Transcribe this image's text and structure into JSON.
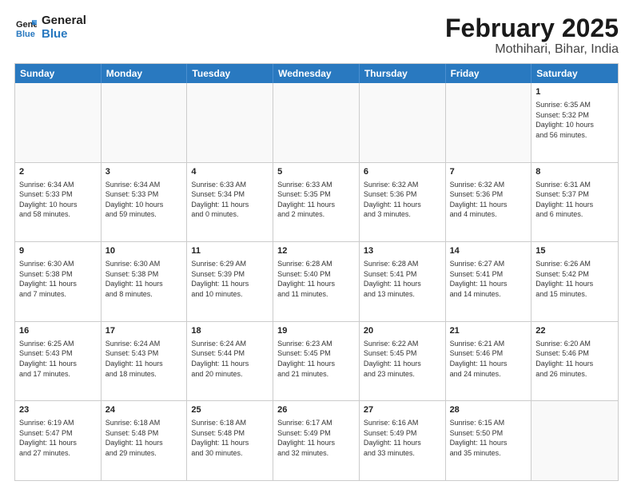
{
  "logo": {
    "text_general": "General",
    "text_blue": "Blue"
  },
  "title": "February 2025",
  "subtitle": "Mothihari, Bihar, India",
  "header_days": [
    "Sunday",
    "Monday",
    "Tuesday",
    "Wednesday",
    "Thursday",
    "Friday",
    "Saturday"
  ],
  "rows": [
    [
      {
        "num": "",
        "text": "",
        "empty": true
      },
      {
        "num": "",
        "text": "",
        "empty": true
      },
      {
        "num": "",
        "text": "",
        "empty": true
      },
      {
        "num": "",
        "text": "",
        "empty": true
      },
      {
        "num": "",
        "text": "",
        "empty": true
      },
      {
        "num": "",
        "text": "",
        "empty": true
      },
      {
        "num": "1",
        "text": "Sunrise: 6:35 AM\nSunset: 5:32 PM\nDaylight: 10 hours\nand 56 minutes.",
        "empty": false
      }
    ],
    [
      {
        "num": "2",
        "text": "Sunrise: 6:34 AM\nSunset: 5:33 PM\nDaylight: 10 hours\nand 58 minutes.",
        "empty": false
      },
      {
        "num": "3",
        "text": "Sunrise: 6:34 AM\nSunset: 5:33 PM\nDaylight: 10 hours\nand 59 minutes.",
        "empty": false
      },
      {
        "num": "4",
        "text": "Sunrise: 6:33 AM\nSunset: 5:34 PM\nDaylight: 11 hours\nand 0 minutes.",
        "empty": false
      },
      {
        "num": "5",
        "text": "Sunrise: 6:33 AM\nSunset: 5:35 PM\nDaylight: 11 hours\nand 2 minutes.",
        "empty": false
      },
      {
        "num": "6",
        "text": "Sunrise: 6:32 AM\nSunset: 5:36 PM\nDaylight: 11 hours\nand 3 minutes.",
        "empty": false
      },
      {
        "num": "7",
        "text": "Sunrise: 6:32 AM\nSunset: 5:36 PM\nDaylight: 11 hours\nand 4 minutes.",
        "empty": false
      },
      {
        "num": "8",
        "text": "Sunrise: 6:31 AM\nSunset: 5:37 PM\nDaylight: 11 hours\nand 6 minutes.",
        "empty": false
      }
    ],
    [
      {
        "num": "9",
        "text": "Sunrise: 6:30 AM\nSunset: 5:38 PM\nDaylight: 11 hours\nand 7 minutes.",
        "empty": false
      },
      {
        "num": "10",
        "text": "Sunrise: 6:30 AM\nSunset: 5:38 PM\nDaylight: 11 hours\nand 8 minutes.",
        "empty": false
      },
      {
        "num": "11",
        "text": "Sunrise: 6:29 AM\nSunset: 5:39 PM\nDaylight: 11 hours\nand 10 minutes.",
        "empty": false
      },
      {
        "num": "12",
        "text": "Sunrise: 6:28 AM\nSunset: 5:40 PM\nDaylight: 11 hours\nand 11 minutes.",
        "empty": false
      },
      {
        "num": "13",
        "text": "Sunrise: 6:28 AM\nSunset: 5:41 PM\nDaylight: 11 hours\nand 13 minutes.",
        "empty": false
      },
      {
        "num": "14",
        "text": "Sunrise: 6:27 AM\nSunset: 5:41 PM\nDaylight: 11 hours\nand 14 minutes.",
        "empty": false
      },
      {
        "num": "15",
        "text": "Sunrise: 6:26 AM\nSunset: 5:42 PM\nDaylight: 11 hours\nand 15 minutes.",
        "empty": false
      }
    ],
    [
      {
        "num": "16",
        "text": "Sunrise: 6:25 AM\nSunset: 5:43 PM\nDaylight: 11 hours\nand 17 minutes.",
        "empty": false
      },
      {
        "num": "17",
        "text": "Sunrise: 6:24 AM\nSunset: 5:43 PM\nDaylight: 11 hours\nand 18 minutes.",
        "empty": false
      },
      {
        "num": "18",
        "text": "Sunrise: 6:24 AM\nSunset: 5:44 PM\nDaylight: 11 hours\nand 20 minutes.",
        "empty": false
      },
      {
        "num": "19",
        "text": "Sunrise: 6:23 AM\nSunset: 5:45 PM\nDaylight: 11 hours\nand 21 minutes.",
        "empty": false
      },
      {
        "num": "20",
        "text": "Sunrise: 6:22 AM\nSunset: 5:45 PM\nDaylight: 11 hours\nand 23 minutes.",
        "empty": false
      },
      {
        "num": "21",
        "text": "Sunrise: 6:21 AM\nSunset: 5:46 PM\nDaylight: 11 hours\nand 24 minutes.",
        "empty": false
      },
      {
        "num": "22",
        "text": "Sunrise: 6:20 AM\nSunset: 5:46 PM\nDaylight: 11 hours\nand 26 minutes.",
        "empty": false
      }
    ],
    [
      {
        "num": "23",
        "text": "Sunrise: 6:19 AM\nSunset: 5:47 PM\nDaylight: 11 hours\nand 27 minutes.",
        "empty": false
      },
      {
        "num": "24",
        "text": "Sunrise: 6:18 AM\nSunset: 5:48 PM\nDaylight: 11 hours\nand 29 minutes.",
        "empty": false
      },
      {
        "num": "25",
        "text": "Sunrise: 6:18 AM\nSunset: 5:48 PM\nDaylight: 11 hours\nand 30 minutes.",
        "empty": false
      },
      {
        "num": "26",
        "text": "Sunrise: 6:17 AM\nSunset: 5:49 PM\nDaylight: 11 hours\nand 32 minutes.",
        "empty": false
      },
      {
        "num": "27",
        "text": "Sunrise: 6:16 AM\nSunset: 5:49 PM\nDaylight: 11 hours\nand 33 minutes.",
        "empty": false
      },
      {
        "num": "28",
        "text": "Sunrise: 6:15 AM\nSunset: 5:50 PM\nDaylight: 11 hours\nand 35 minutes.",
        "empty": false
      },
      {
        "num": "",
        "text": "",
        "empty": true
      }
    ]
  ]
}
